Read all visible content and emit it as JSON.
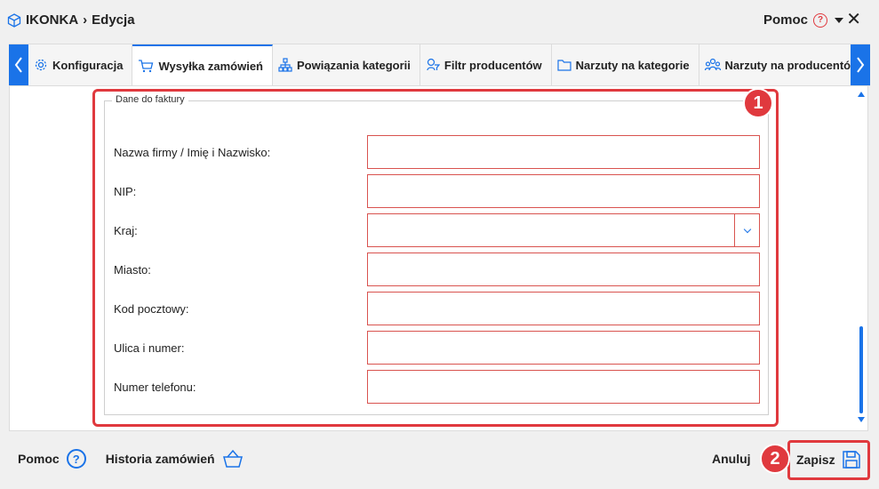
{
  "window": {
    "app": "IKONKA",
    "separator": "›",
    "mode": "Edycja",
    "help_label": "Pomoc",
    "help_icon": "?",
    "close_icon": "✕"
  },
  "tabs": [
    {
      "label": "Konfiguracja",
      "icon": "gear-icon",
      "active": false
    },
    {
      "label": "Wysyłka zamówień",
      "icon": "cart-icon",
      "active": true
    },
    {
      "label": "Powiązania kategorii",
      "icon": "hierarchy-icon",
      "active": false
    },
    {
      "label": "Filtr producentów",
      "icon": "filter-icon",
      "active": false
    },
    {
      "label": "Narzuty na kategorie",
      "icon": "folder-icon",
      "active": false
    },
    {
      "label": "Narzuty na producentów",
      "icon": "users-icon",
      "active": false
    }
  ],
  "invoice": {
    "legend": "Dane do faktury",
    "fields": [
      {
        "label": "Nazwa firmy / Imię i Nazwisko:",
        "value": "",
        "type": "text"
      },
      {
        "label": "NIP:",
        "value": "",
        "type": "text"
      },
      {
        "label": "Kraj:",
        "value": "",
        "type": "select"
      },
      {
        "label": "Miasto:",
        "value": "",
        "type": "text"
      },
      {
        "label": "Kod pocztowy:",
        "value": "",
        "type": "text"
      },
      {
        "label": "Ulica i numer:",
        "value": "",
        "type": "text"
      },
      {
        "label": "Numer telefonu:",
        "value": "",
        "type": "text"
      }
    ]
  },
  "badges": {
    "one": "1",
    "two": "2"
  },
  "footer": {
    "help_label": "Pomoc",
    "help_icon": "?",
    "history_label": "Historia zamówień",
    "cancel_label": "Anuluj",
    "save_label": "Zapisz"
  },
  "colors": {
    "accent": "#1a73e8",
    "highlight": "#e0393e",
    "invalid_border": "#d9534f"
  }
}
